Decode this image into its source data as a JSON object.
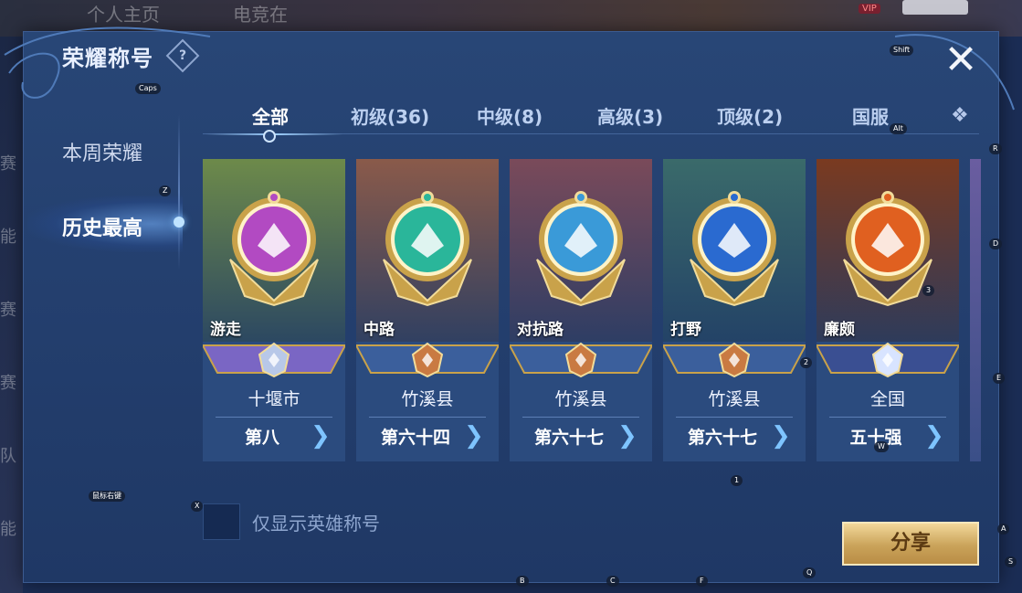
{
  "background": {
    "top_texts": [
      "个人主页",
      "电竞在"
    ],
    "vip_label": "VIP",
    "left_chars": [
      "赛",
      "能",
      "赛",
      "赛",
      "队",
      "能"
    ]
  },
  "panel": {
    "title": "荣耀称号",
    "help_icon": "?",
    "close_icon": "✕"
  },
  "sidebar": {
    "items": [
      {
        "label": "本周荣耀",
        "active": false
      },
      {
        "label": "历史最高",
        "active": true
      }
    ]
  },
  "tabs": [
    {
      "label": "全部",
      "active": true
    },
    {
      "label": "初级(36)",
      "active": false
    },
    {
      "label": "中级(8)",
      "active": false
    },
    {
      "label": "高级(3)",
      "active": false
    },
    {
      "label": "顶级(2)",
      "active": false
    },
    {
      "label": "国服",
      "active": false
    }
  ],
  "cards": [
    {
      "position": "游走",
      "region": "十堰市",
      "rank": "第八",
      "tier": "silver",
      "theme": "#6d8a4a",
      "emblem": "#b24ac2"
    },
    {
      "position": "中路",
      "region": "竹溪县",
      "rank": "第六十四",
      "tier": "bronze",
      "theme": "#8a5a4a",
      "emblem": "#2ab69a"
    },
    {
      "position": "对抗路",
      "region": "竹溪县",
      "rank": "第六十七",
      "tier": "bronze",
      "theme": "#7a4a5a",
      "emblem": "#3a9ad8"
    },
    {
      "position": "打野",
      "region": "竹溪县",
      "rank": "第六十七",
      "tier": "bronze",
      "theme": "#3a6a6a",
      "emblem": "#2a6ad0"
    },
    {
      "position": "廉颇",
      "region": "全国",
      "rank": "五十强",
      "tier": "gold",
      "theme": "#7a3a20",
      "emblem": "#e06020"
    }
  ],
  "filter": {
    "checkbox_label": "仅显示英雄称号",
    "checked": false
  },
  "share_button": "分享",
  "key_hints": {
    "caps": "Caps",
    "shift": "Shift",
    "alt": "Alt",
    "z": "Z",
    "r": "R",
    "d": "D",
    "n3": "3",
    "n2": "2",
    "e": "E",
    "w": "W",
    "n1": "1",
    "x": "X",
    "mouse": "鼠标右键",
    "a": "A",
    "s": "S",
    "b": "B",
    "c": "C",
    "f": "F",
    "q": "Q"
  }
}
